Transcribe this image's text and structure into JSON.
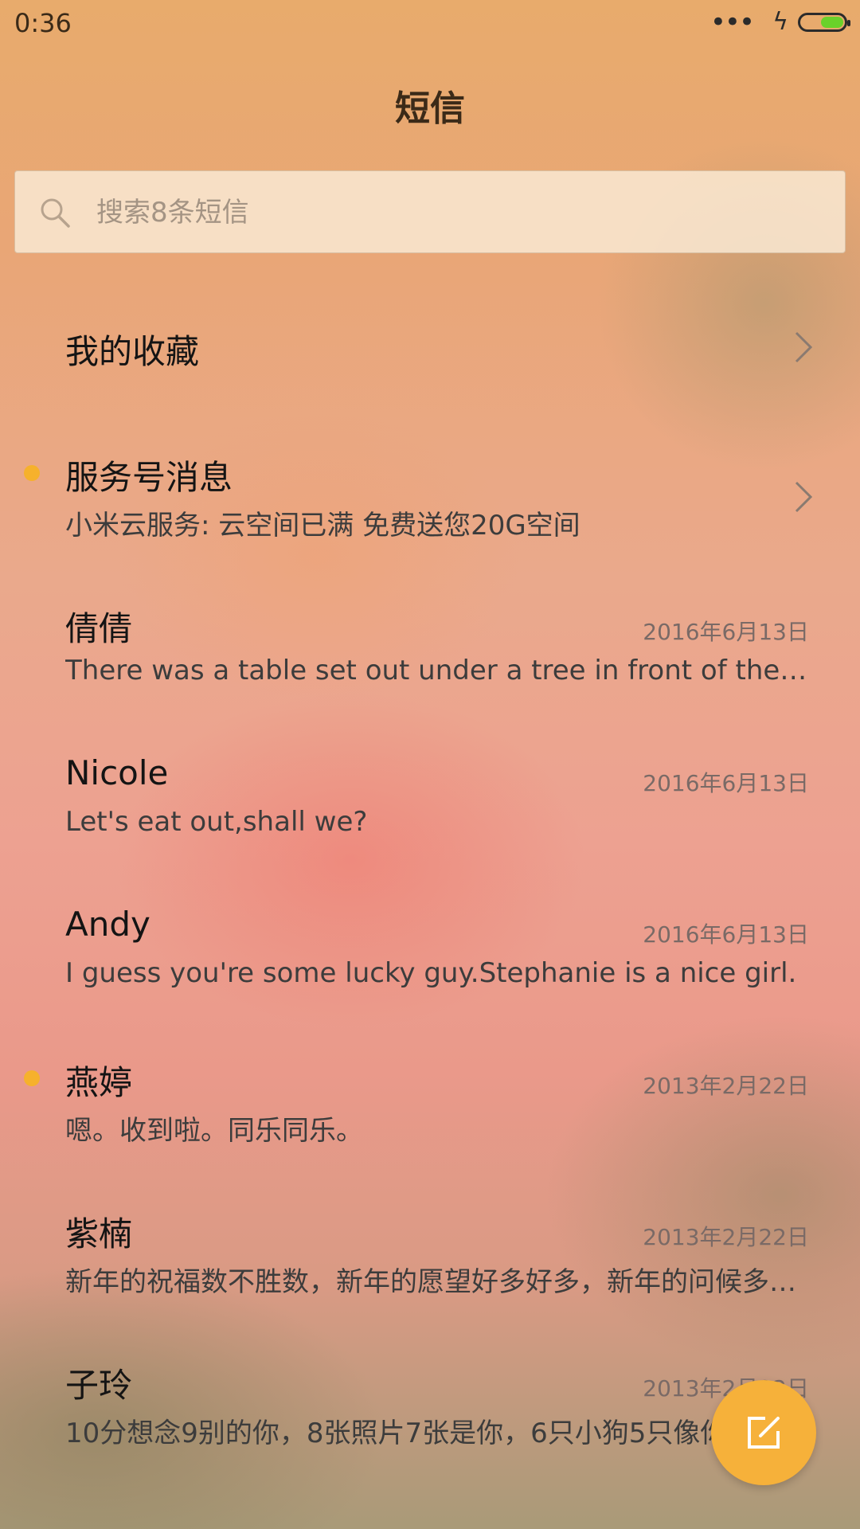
{
  "status_bar": {
    "time": "0:36",
    "signal_dots": "•••",
    "charging_symbol": "ϟ",
    "battery_level": 1.0,
    "battery_color": "#6ad12a"
  },
  "header": {
    "title": "短信"
  },
  "search": {
    "placeholder": "搜索8条短信"
  },
  "favorites": {
    "label": "我的收藏"
  },
  "service": {
    "title": "服务号消息",
    "preview": "小米云服务: 云空间已满 免费送您20G空间",
    "unread": true
  },
  "conversations": [
    {
      "name": "倩倩",
      "date": "2016年6月13日",
      "preview": "There was a table set out under a tree in front of the house, and the March Hare and the Hatter were having tea at it",
      "unread": false
    },
    {
      "name": "Nicole",
      "date": "2016年6月13日",
      "preview": "Let's eat out,shall we?",
      "unread": false
    },
    {
      "name": "Andy",
      "date": "2016年6月13日",
      "preview": "I guess you're some lucky guy.Stephanie is a nice girl.",
      "unread": false
    },
    {
      "name": "燕婷",
      "date": "2013年2月22日",
      "preview": "嗯。收到啦。同乐同乐。",
      "unread": true
    },
    {
      "name": "紫楠",
      "date": "2013年2月22日",
      "preview": "新年的祝福数不胜数，新年的愿望好多好多，新年的问候多多益善",
      "unread": false
    },
    {
      "name": "子玲",
      "date": "2013年2月22日",
      "preview": "10分想念9别的你，8张照片7张是你，6只小狗5只像你",
      "unread": false
    }
  ],
  "fab": {
    "icon": "compose-icon",
    "color": "#f6b13a"
  },
  "colors": {
    "accent": "#f6b13a",
    "unread_dot": "#f6b12c"
  }
}
